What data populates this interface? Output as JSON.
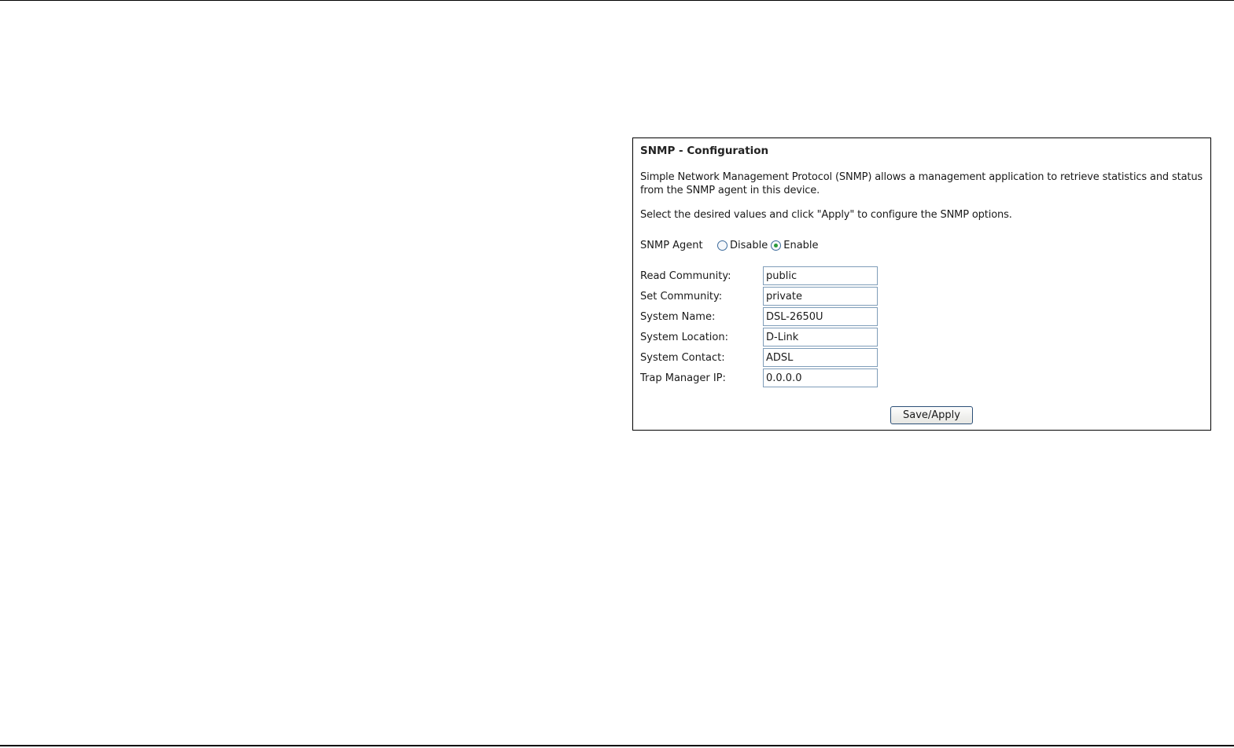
{
  "snmp": {
    "title": "SNMP - Configuration",
    "description": "Simple Network Management Protocol (SNMP) allows a management application to retrieve statistics and status from the SNMP agent in this device.",
    "instruction": "Select the desired values and click \"Apply\" to configure the SNMP options.",
    "agent": {
      "label": "SNMP Agent",
      "options": [
        "Disable",
        "Enable"
      ],
      "selected": "Enable"
    },
    "fields": [
      {
        "label": "Read Community:",
        "value": "public"
      },
      {
        "label": "Set Community:",
        "value": "private"
      },
      {
        "label": "System Name:",
        "value": "DSL-2650U"
      },
      {
        "label": "System Location:",
        "value": "D-Link"
      },
      {
        "label": "System Contact:",
        "value": "ADSL"
      },
      {
        "label": "Trap Manager IP:",
        "value": "0.0.0.0"
      }
    ],
    "save_label": "Save/Apply"
  },
  "colors": {
    "input_border": "#7f9db9",
    "radio_dot": "#2a9a3a",
    "button_border": "#2b4f77"
  }
}
